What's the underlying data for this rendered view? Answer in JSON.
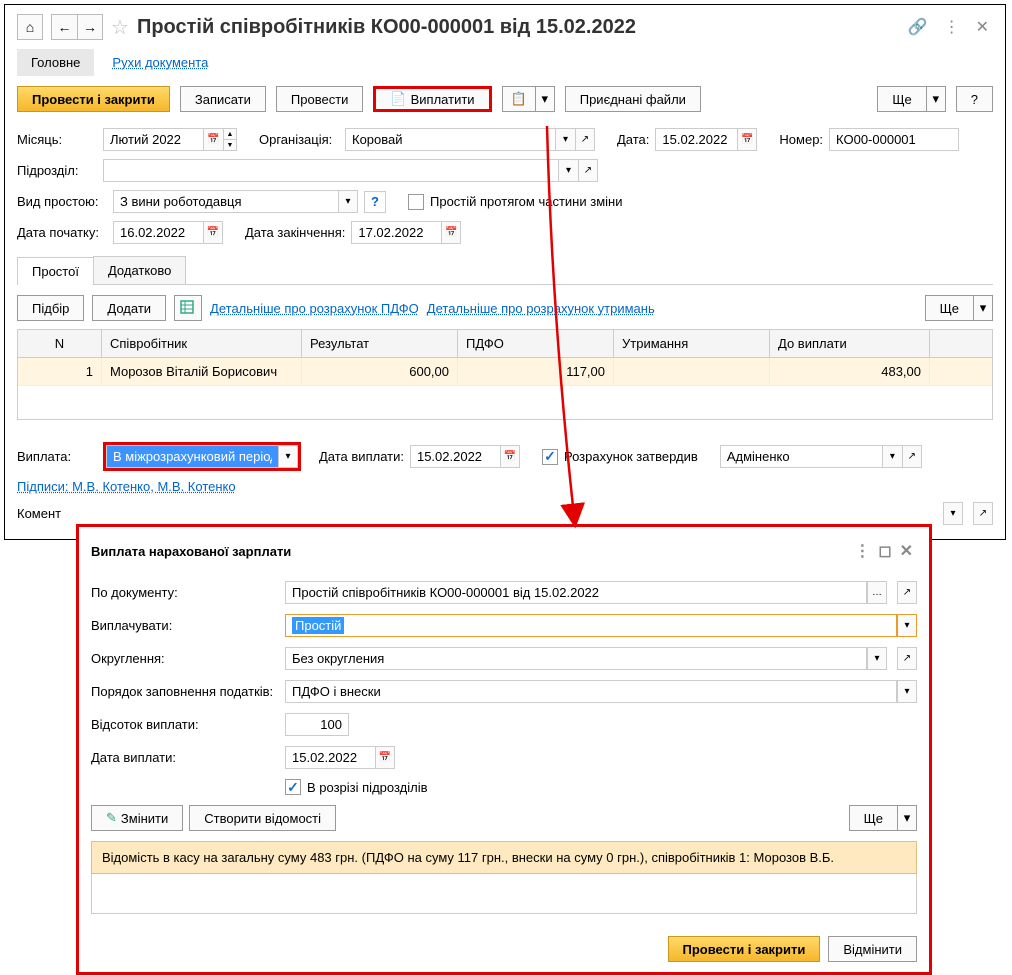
{
  "title": "Простій співробітників КО00-000001 від 15.02.2022",
  "tabs": {
    "main": "Головне",
    "moves": "Рухи документа"
  },
  "toolbar": {
    "conduct_close": "Провести і закрити",
    "save": "Записати",
    "conduct": "Провести",
    "pay": "Виплатити",
    "attached": "Приєднані файли",
    "more": "Ще"
  },
  "fields": {
    "month_label": "Місяць:",
    "month_value": "Лютий 2022",
    "org_label": "Організація:",
    "org_value": "Коровай",
    "date_label": "Дата:",
    "date_value": "15.02.2022",
    "number_label": "Номер:",
    "number_value": "КО00-000001",
    "dept_label": "Підрозділ:",
    "dept_value": "",
    "type_label": "Вид простою:",
    "type_value": "З вини роботодавця",
    "part_shift": "Простій протягом частини зміни",
    "start_label": "Дата початку:",
    "start_value": "16.02.2022",
    "end_label": "Дата закінчення:",
    "end_value": "17.02.2022"
  },
  "subtabs": {
    "idle": "Простої",
    "extra": "Додатково"
  },
  "gridtools": {
    "select": "Підбір",
    "add": "Додати",
    "link_tax": "Детальніше про розрахунок ПДФО",
    "link_ded": "Детальніше про розрахунок утримань",
    "more": "Ще"
  },
  "grid": {
    "headers": {
      "n": "N",
      "emp": "Співробітник",
      "res": "Результат",
      "tax": "ПДФО",
      "ded": "Утримання",
      "pay": "До виплати"
    },
    "row": {
      "n": "1",
      "emp": "Морозов Віталій Борисович",
      "res": "600,00",
      "tax": "117,00",
      "ded": "",
      "pay": "483,00"
    }
  },
  "payment": {
    "label": "Виплата:",
    "value": "В міжрозрахунковий період",
    "date_label": "Дата виплати:",
    "date_value": "15.02.2022",
    "approved_label": "Розрахунок затвердив",
    "approver": "Адміненко"
  },
  "signatures": "Підписи: М.В. Котенко, М.В. Котенко",
  "comment_label": "Комент",
  "dialog": {
    "title": "Виплата нарахованої зарплати",
    "doc_label": "По документу:",
    "doc_value": "Простій співробітників КО00-000001 від 15.02.2022",
    "paytype_label": "Виплачувати:",
    "paytype_value": "Простій",
    "round_label": "Округлення:",
    "round_value": "Без округления",
    "taxorder_label": "Порядок заповнення податків:",
    "taxorder_value": "ПДФО і внески",
    "percent_label": "Відсоток виплати:",
    "percent_value": "100",
    "paydate_label": "Дата виплати:",
    "paydate_value": "15.02.2022",
    "bydept": "В розрізі підрозділів",
    "edit": "Змінити",
    "create": "Створити відомості",
    "more": "Ще",
    "msg": "Відомість в касу на загальну суму 483 грн. (ПДФО на суму 117 грн., внески на суму 0 грн.), співробітників 1: Морозов В.Б.",
    "conduct_close": "Провести і закрити",
    "cancel": "Відмінити"
  }
}
